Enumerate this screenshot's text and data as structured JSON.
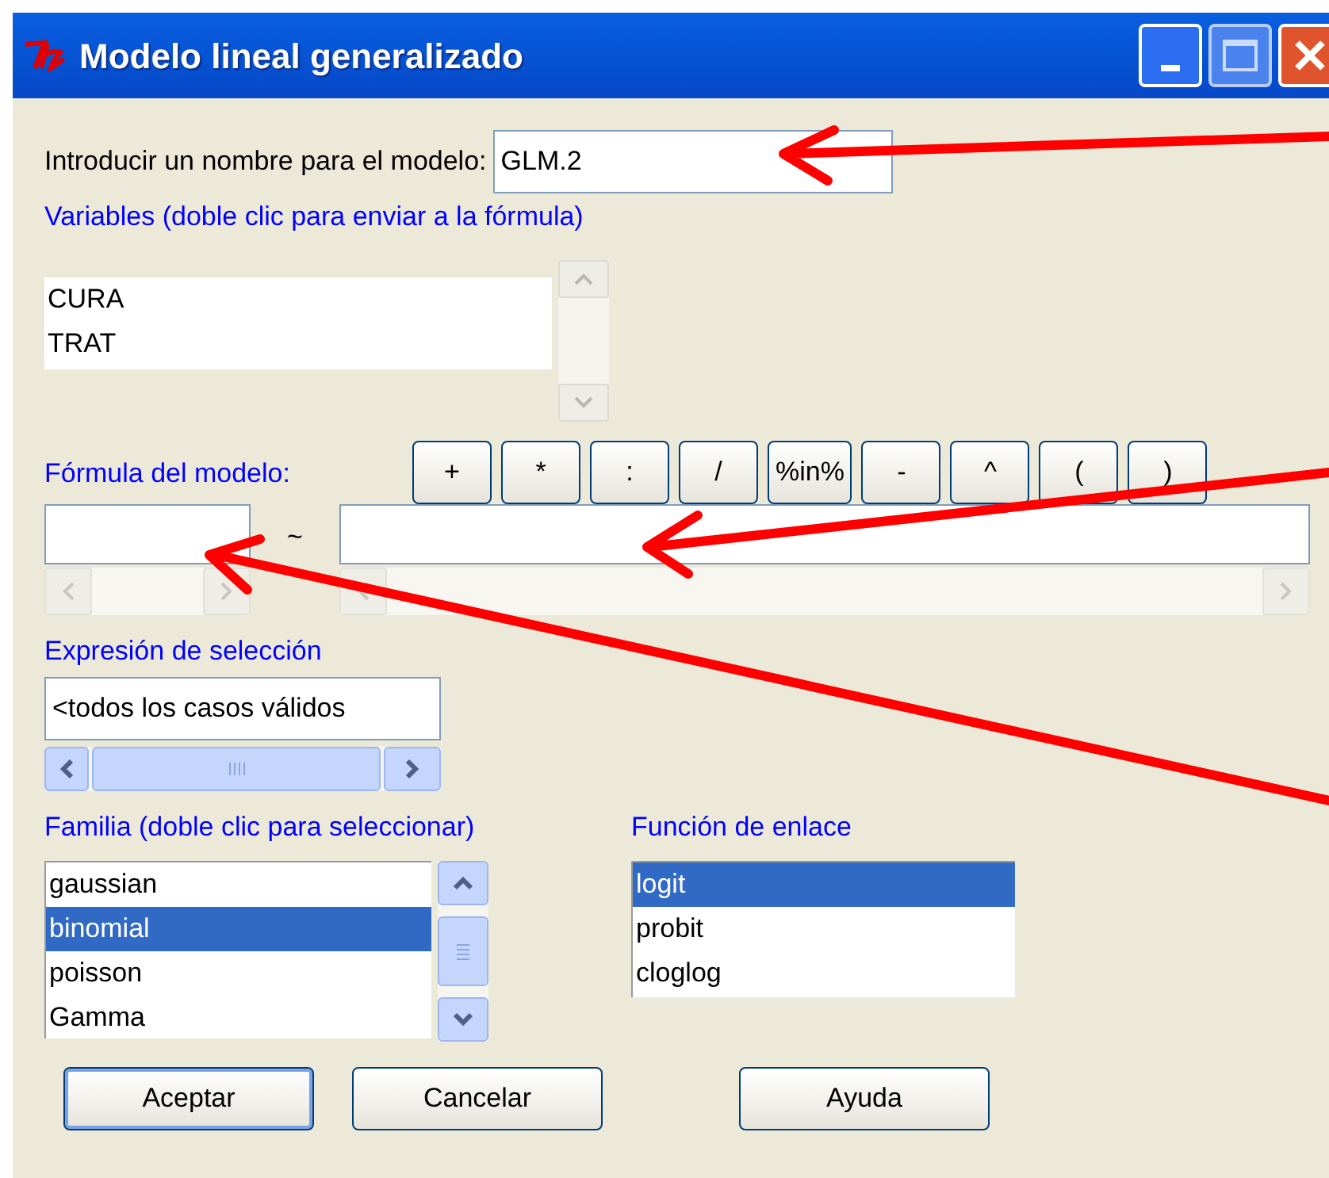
{
  "window": {
    "title": "Modelo lineal generalizado"
  },
  "model_name": {
    "label": "Introducir un nombre para el modelo:",
    "value": "GLM.2"
  },
  "variables": {
    "label": "Variables (doble clic para enviar a la fórmula)",
    "items": [
      {
        "text": "CURA",
        "selected": false
      },
      {
        "text": "TRAT",
        "selected": false
      }
    ]
  },
  "formula": {
    "label": "Fórmula del modelo:",
    "operators": [
      "+",
      "*",
      ":",
      "/",
      "%in%",
      "-",
      "^",
      "(",
      ")"
    ],
    "tilde": "~"
  },
  "subset": {
    "label": "Expresión de selección",
    "value": "<todos los casos válidos"
  },
  "family": {
    "label": "Familia (doble clic para seleccionar)",
    "items": [
      {
        "text": "gaussian",
        "selected": false
      },
      {
        "text": "binomial",
        "selected": true
      },
      {
        "text": "poisson",
        "selected": false
      },
      {
        "text": "Gamma",
        "selected": false
      }
    ]
  },
  "link": {
    "label": "Función de enlace",
    "items": [
      {
        "text": "logit",
        "selected": true
      },
      {
        "text": "probit",
        "selected": false
      },
      {
        "text": "cloglog",
        "selected": false
      }
    ]
  },
  "buttons": [
    {
      "label": "Aceptar",
      "default": true
    },
    {
      "label": "Cancelar",
      "default": false
    },
    {
      "label": "Ayuda",
      "default": false
    }
  ]
}
